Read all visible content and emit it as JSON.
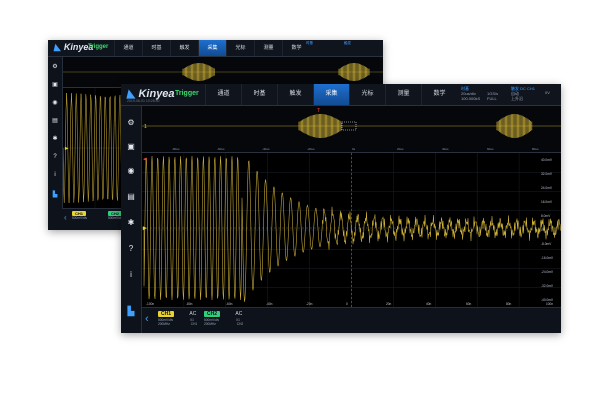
{
  "brand": {
    "name": "Kinyea",
    "timestamp": "2019-06-01 10:26:40"
  },
  "trigger_label": "Trigger",
  "menu": [
    "通道",
    "时基",
    "触发",
    "采集",
    "光标",
    "测量",
    "数学"
  ],
  "menu_active": 3,
  "status": {
    "timebase_label": "时基",
    "timebase_value": "20us/div",
    "sample_rate": "1GS/s",
    "mode": "FULL",
    "points": "100.000kS",
    "trigger_label": "触发",
    "coupling": "DC",
    "channel": "CH1",
    "trig_mode": "自动",
    "trig_level": "0V",
    "state": "上升沿"
  },
  "sidebar_icons": [
    "gear-icon",
    "save-icon",
    "mask-icon",
    "display-icon",
    "settings-icon",
    "help-icon",
    "info-icon",
    "logo-icon"
  ],
  "channels": [
    {
      "name": "CH1",
      "coupling": "AC",
      "scale": "500mV/div",
      "bandwidth": "200MHz",
      "probe": "X1",
      "ch": "CH1",
      "color": "#e8d330"
    },
    {
      "name": "CH2",
      "coupling": "AC",
      "scale": "500mV/div",
      "bandwidth": "200MHz",
      "probe": "X1",
      "ch": "CH2",
      "color": "#2fd07b"
    }
  ],
  "y_ticks": [
    "40.0mV",
    "32.0mV",
    "24.0mV",
    "16.0mV",
    "8.0mV",
    "0V",
    "-8.0mV",
    "-16.0mV",
    "-24.0mV",
    "-32.0mV",
    "-40.0mV"
  ],
  "x_ticks": [
    "-100n",
    "-80n",
    "-60n",
    "-40n",
    "-20n",
    "0",
    "20n",
    "40n",
    "60n",
    "80n",
    "100n"
  ],
  "overview_ticks": [
    "-80us",
    "-60us",
    "-40us",
    "-20us",
    "0s",
    "20us",
    "40us",
    "60us",
    "80us"
  ],
  "wave_color": "#d4b638"
}
